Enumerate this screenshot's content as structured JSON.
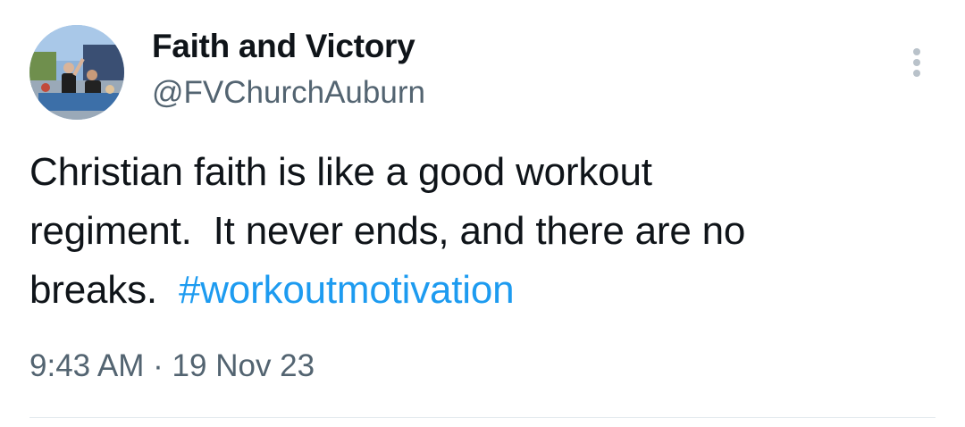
{
  "author": {
    "display_name": "Faith and Victory",
    "handle": "@FVChurchAuburn"
  },
  "tweet": {
    "text_before_hashtag": "Christian faith is like a good workout\nregiment.  It never ends, and there are no\nbreaks.  ",
    "hashtag": "#workoutmotivation"
  },
  "meta": {
    "time": "9:43 AM",
    "separator": "·",
    "date": "19 Nov 23"
  },
  "icons": {
    "more": "more-vertical-icon"
  },
  "colors": {
    "text": "#0f1419",
    "secondary": "#536471",
    "link": "#1d9bf0",
    "divider": "#e1e8ed"
  }
}
